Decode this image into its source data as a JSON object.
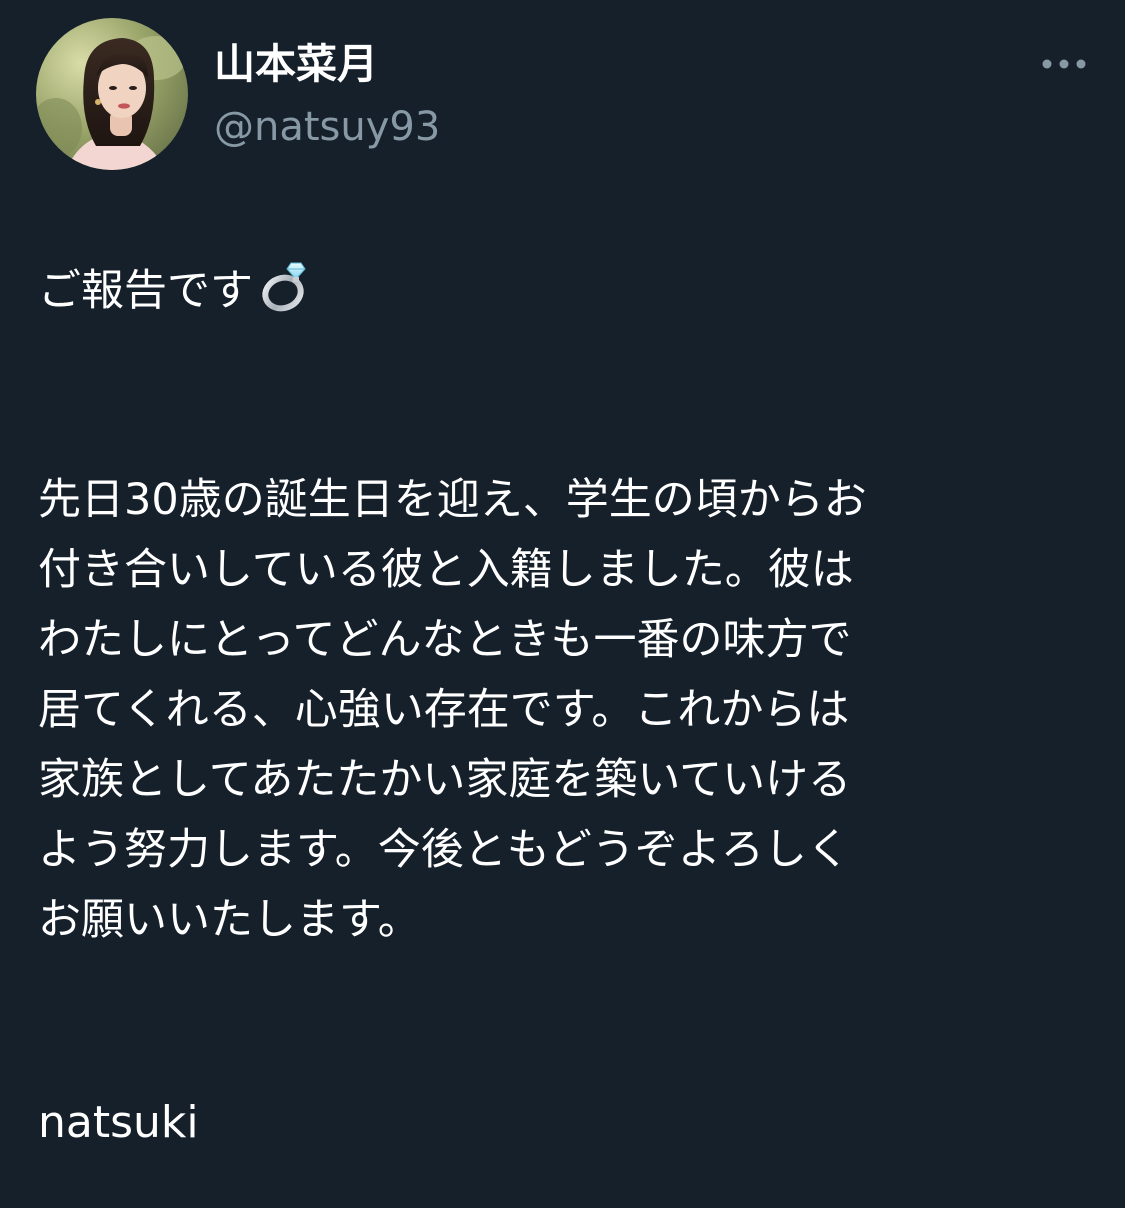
{
  "author": {
    "display_name": "山本菜月",
    "handle": "@natsuy93"
  },
  "tweet": {
    "headline": "ご報告です",
    "headline_emoji": "ring",
    "paragraph_lines": [
      "先日30歳の誕生日を迎え、学生の頃からお",
      "付き合いしている彼と入籍しました。彼は",
      "わたしにとってどんなときも一番の味方で",
      "居てくれる、心強い存在です。これからは",
      "家族としてあたたかい家庭を築いていける",
      "よう努力します。今後ともどうぞよろしく",
      "お願いいたします。"
    ],
    "signature": "natsuki"
  },
  "icons": {
    "more": "more-horizontal-icon",
    "ring": "ring-icon"
  },
  "colors": {
    "background": "#15202b",
    "text": "#ffffff",
    "secondary_text": "#8899a6"
  }
}
